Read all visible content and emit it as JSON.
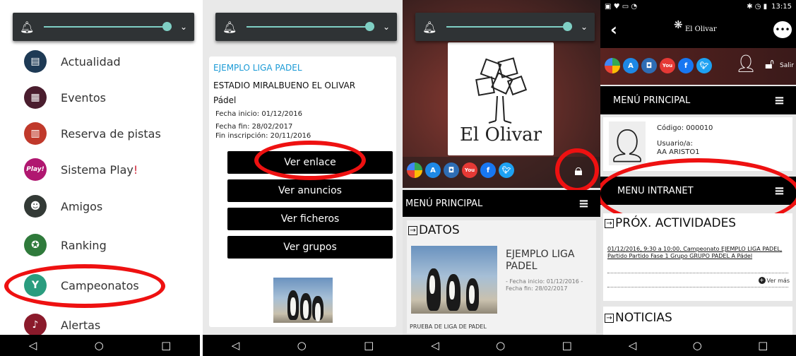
{
  "panel1": {
    "menu_items": [
      {
        "label": "Actualidad",
        "icon": "newspaper-icon",
        "color": "#1e3a55"
      },
      {
        "label": "Eventos",
        "icon": "calendar-icon",
        "color": "#4a1d2e"
      },
      {
        "label": "Reserva de pistas",
        "icon": "court-icon",
        "color": "#c0392b"
      },
      {
        "label_prefix": "Sistema Play",
        "label_suffix": "!",
        "icon_text": "Play!",
        "icon": "play-icon",
        "color": "#b01770"
      },
      {
        "label": "Amigos",
        "icon": "friends-icon",
        "color": "#333a36"
      },
      {
        "label": "Ranking",
        "icon": "ranking-icon",
        "color": "#2f7a3b"
      },
      {
        "label": "Campeonatos",
        "icon": "trophy-icon",
        "color": "#2a9d7f"
      },
      {
        "label": "Alertas",
        "icon": "bell-icon",
        "color": "#8b1a2b"
      }
    ]
  },
  "panel2": {
    "league_title": "EJEMPLO LIGA PADEL",
    "venue": "ESTADIO MIRALBUENO EL OLIVAR",
    "sport": "Pádel",
    "start_date": "Fecha inicio: 01/12/2016",
    "end_date": "Fecha fin: 28/02/2017",
    "registration_end": "Fin inscripción: 20/11/2016",
    "buttons": [
      "Ver enlace",
      "Ver anuncios",
      "Ver ficheros",
      "Ver grupos"
    ]
  },
  "panel3": {
    "logo_text": "El Olivar",
    "menu_title": "MENÚ PRINCIPAL",
    "section_title": "DATOS",
    "event_title": "EJEMPLO LIGA PADEL",
    "event_dates": "- Fecha inicio: 01/12/2016     -     Fecha fin: 28/02/2017",
    "description": "PRUEBA DE LIGA DE PADEL"
  },
  "panel4": {
    "status_time": "13:15",
    "header_logo": "El Olivar",
    "salir": "Salir",
    "menu_title": "MENÚ PRINCIPAL",
    "code": "Código: 000010",
    "user_label": "Usuario/a:",
    "user_name": "AA ARISTO1",
    "intranet_title": "MENU INTRANET",
    "activities_title": "PRÓX. ACTIVIDADES",
    "activity_text": "01/12/2016, 9:30 a 10:00. Campeonato EJEMPLO LIGA PADEL, Partido Partido Fase 1 Grupo GRUPO PADEL A Pádel",
    "ver_mas": "Ver más",
    "news_title": "NOTICIAS"
  },
  "social_icons": [
    "google-play-icon",
    "app-store-icon",
    "instagram-icon",
    "youtube-icon",
    "facebook-icon",
    "twitter-icon"
  ],
  "colors": {
    "accent_red": "#ee1111",
    "slider_teal": "#7fcfc4",
    "link_blue": "#1a6fc4"
  }
}
